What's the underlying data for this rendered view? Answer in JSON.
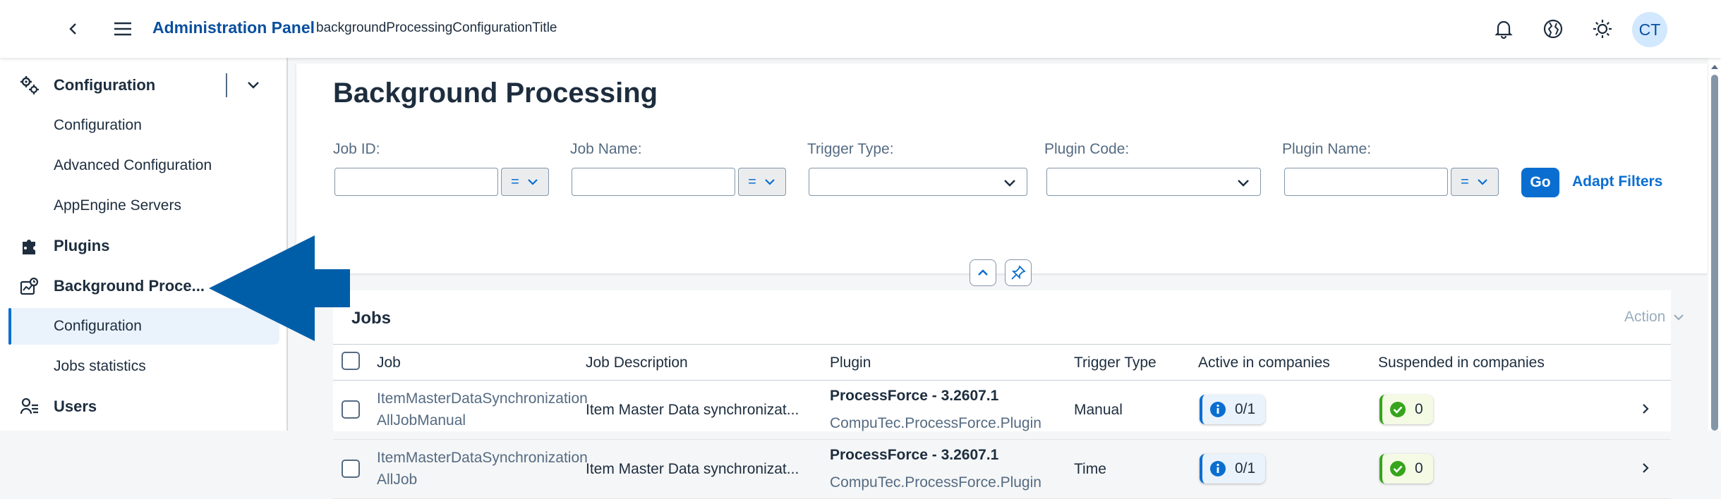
{
  "header": {
    "app_title": "Administration Panel",
    "subtitle": "backgroundProcessingConfigurationTitle",
    "avatar_initials": "CT"
  },
  "sidebar": {
    "groups": [
      {
        "label": "Configuration",
        "icon": "gears-icon"
      },
      {
        "label": "Plugins",
        "icon": "puzzle-icon"
      },
      {
        "label": "Background Proce...",
        "icon": "background-processing-icon"
      },
      {
        "label": "Users",
        "icon": "user-list-icon"
      }
    ],
    "config_items": [
      "Configuration",
      "Advanced Configuration",
      "AppEngine Servers"
    ],
    "bg_items": [
      "Configuration",
      "Jobs statistics"
    ]
  },
  "page": {
    "title": "Background Processing",
    "filters": {
      "job_id_label": "Job ID:",
      "job_name_label": "Job Name:",
      "trigger_type_label": "Trigger Type:",
      "plugin_code_label": "Plugin Code:",
      "plugin_name_label": "Plugin Name:",
      "operator": "="
    },
    "go_label": "Go",
    "adapt_filters_label": "Adapt Filters"
  },
  "table": {
    "title": "Jobs",
    "action_label": "Action",
    "columns": [
      "Job",
      "Job Description",
      "Plugin",
      "Trigger Type",
      "Active in companies",
      "Suspended in companies"
    ],
    "rows": [
      {
        "job_line1": "ItemMasterDataSynchronization",
        "job_line2": "AllJobManual",
        "description": "Item Master Data synchronizat...",
        "plugin_name": "ProcessForce - 3.2607.1",
        "plugin_code": "CompuTec.ProcessForce.Plugin",
        "trigger": "Manual",
        "active": "0/1",
        "suspended": "0"
      },
      {
        "job_line1": "ItemMasterDataSynchronization",
        "job_line2": "AllJob",
        "description": "Item Master Data synchronizat...",
        "plugin_name": "ProcessForce - 3.2607.1",
        "plugin_code": "CompuTec.ProcessForce.Plugin",
        "trigger": "Time",
        "active": "0/1",
        "suspended": "0"
      }
    ]
  },
  "colors": {
    "brand": "#0a4f9e",
    "accent": "#0a6ed1",
    "annotation_arrow": "#005ea8",
    "success": "#36a41d"
  }
}
